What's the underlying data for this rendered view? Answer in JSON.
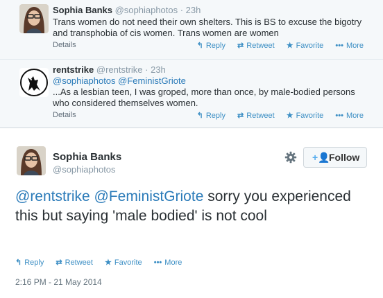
{
  "reply_1": {
    "name": "Sophia Banks",
    "handle": "@sophiaphotos · 23h",
    "text": "Trans women do not need their own shelters. This is BS to excuse the bigotry and transphobia of cis women. Trans women are women",
    "details": "Details",
    "actions": {
      "reply": "Reply",
      "retweet": "Retweet",
      "favorite": "Favorite",
      "more": "More"
    }
  },
  "reply_2": {
    "name": "rentstrike",
    "handle": "@rentstrike · 23h",
    "mentions": "@sophiaphotos @FeministGriote",
    "text": "...As a lesbian teen, I was groped, more than once, by male-bodied persons who considered themselves women.",
    "details": "Details",
    "actions": {
      "reply": "Reply",
      "retweet": "Retweet",
      "favorite": "Favorite",
      "more": "More"
    }
  },
  "main_tweet": {
    "name": "Sophia Banks",
    "handle": "@sophiaphotos",
    "follow_label": "Follow",
    "mention_1": "@rentstrike",
    "mention_2": "@FeministGriote",
    "text": " sorry you experienced this but saying 'male bodied' is not cool",
    "actions": {
      "reply": "Reply",
      "retweet": "Retweet",
      "favorite": "Favorite",
      "more": "More"
    },
    "timestamp": "2:16 PM - 21 May 2014"
  },
  "icons": {
    "reply": "reply-arrow-icon",
    "retweet": "retweet-icon",
    "favorite": "star-icon",
    "more": "dots-icon",
    "settings": "gear-icon",
    "follow": "add-user-icon"
  },
  "colors": {
    "link": "#2b7bb9",
    "action": "#3b8ec4",
    "thread_bg": "#f5f8fa",
    "follow_icon": "#55acee"
  }
}
